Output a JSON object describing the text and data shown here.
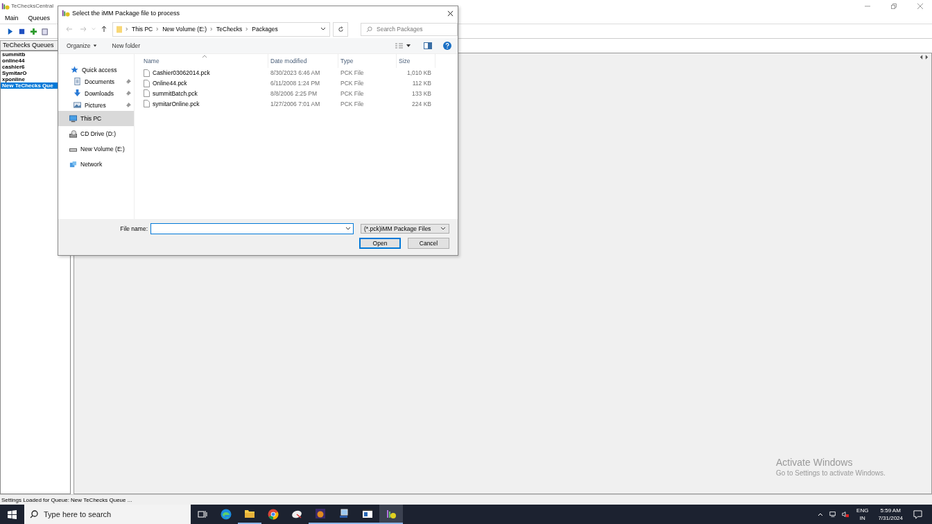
{
  "main_window": {
    "title": "TeChecksCentral",
    "menu": [
      {
        "label": "Main"
      },
      {
        "label": "Queues"
      }
    ],
    "queue_panel": {
      "header": "TeChecks Queues",
      "items": [
        {
          "label": "summitb",
          "selected": false
        },
        {
          "label": "online44",
          "selected": false
        },
        {
          "label": "cashier6",
          "selected": false
        },
        {
          "label": "SymitarO",
          "selected": false
        },
        {
          "label": "xponline",
          "selected": false
        },
        {
          "label": "New TeChecks Que",
          "selected": true
        }
      ]
    },
    "status_bar": "Settings Loaded for Queue: New TeChecks Queue ..."
  },
  "dialog": {
    "title": "Select the iMM Package file to process",
    "breadcrumb": [
      "This PC",
      "New Volume (E:)",
      "TeChecks",
      "Packages"
    ],
    "search": {
      "placeholder": "Search Packages"
    },
    "toolbar": [
      "Organize",
      "New folder"
    ],
    "nav": [
      {
        "label": "Quick access",
        "kind": "star",
        "selected": false,
        "children": [
          {
            "label": "Documents",
            "kind": "documents",
            "selected": false
          },
          {
            "label": "Downloads",
            "kind": "downloads",
            "selected": false
          },
          {
            "label": "Pictures",
            "kind": "pictures",
            "selected": false
          }
        ]
      },
      {
        "label": "This PC",
        "kind": "pc",
        "selected": true
      },
      {
        "label": "CD Drive (D:)",
        "kind": "cd",
        "selected": false
      },
      {
        "label": "New Volume (E:)",
        "kind": "drive",
        "selected": false
      },
      {
        "label": "Network",
        "kind": "network",
        "selected": false
      }
    ],
    "columns": [
      "Name",
      "Date modified",
      "Type",
      "Size"
    ],
    "files": [
      {
        "name": "Cashier03062014.pck",
        "date": "8/30/2023 6:46 AM",
        "type": "PCK File",
        "size": "1,010 KB"
      },
      {
        "name": "Online44.pck",
        "date": "6/11/2008 1:24 PM",
        "type": "PCK File",
        "size": "112 KB"
      },
      {
        "name": "summitBatch.pck",
        "date": "8/8/2006 2:25 PM",
        "type": "PCK File",
        "size": "133 KB"
      },
      {
        "name": "symitarOnline.pck",
        "date": "1/27/2006 7:01 AM",
        "type": "PCK File",
        "size": "224 KB"
      }
    ],
    "file_name_label": "File name:",
    "file_type": "(*.pck)iMM Package Files",
    "buttons": [
      "Open",
      "Cancel"
    ]
  },
  "watermark": {
    "title": "Activate Windows",
    "text": "Go to Settings to activate Windows."
  },
  "taskbar": {
    "search": {
      "placeholder": "Type here to search"
    },
    "apps": [
      {
        "kind": "taskview",
        "running": false,
        "selected": false
      },
      {
        "kind": "edge",
        "running": false,
        "selected": false
      },
      {
        "kind": "folder",
        "running": true,
        "selected": false
      },
      {
        "kind": "chrome",
        "running": false,
        "selected": false
      },
      {
        "kind": "satellite",
        "running": false,
        "selected": false
      },
      {
        "kind": "tiger",
        "running": true,
        "selected": false
      },
      {
        "kind": "computer",
        "running": true,
        "selected": false
      },
      {
        "kind": "window",
        "running": true,
        "selected": false
      },
      {
        "kind": "logo",
        "running": true,
        "selected": true
      }
    ],
    "language": "ENG",
    "region": "IN",
    "time": "5:59 AM",
    "date": "7/31/2024"
  }
}
